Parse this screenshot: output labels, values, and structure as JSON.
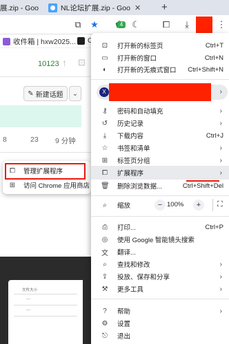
{
  "tabs": [
    {
      "title": "展.zip - Goo"
    },
    {
      "title": "NL论坛扩展.zip - Goo"
    }
  ],
  "new_tab_glyph": "+",
  "toolbar": {
    "extension_badge": "4",
    "icons": [
      "cast-icon",
      "bookmark-star-icon",
      "extension-shield-icon",
      "moon-icon",
      "puzzle-icon",
      "download-icon",
      "kebab-menu-icon"
    ]
  },
  "bookmarks": [
    {
      "label": "收件箱 | hxw2025..."
    },
    {
      "label": "Crea"
    }
  ],
  "page": {
    "count": "10123",
    "new_topic_label": "新建话题",
    "stats": [
      "8",
      "23",
      "9 分钟"
    ],
    "file_size_label": "文件大小"
  },
  "submenu": {
    "items": [
      {
        "label": "管理扩展程序",
        "icon": "puzzle-icon"
      },
      {
        "label": "访问 Chrome 应用商店",
        "icon": "store-icon"
      }
    ]
  },
  "menu": {
    "new_tab": {
      "label": "打开新的标签页",
      "shortcut": "Ctrl+T"
    },
    "new_window": {
      "label": "打开新的窗口",
      "shortcut": "Ctrl+N"
    },
    "incognito": {
      "label": "打开新的无痕式窗口",
      "shortcut": "Ctrl+Shift+N"
    },
    "profile_initial": "X",
    "passwords": {
      "label": "密码和自动填充"
    },
    "history": {
      "label": "历史记录"
    },
    "downloads": {
      "label": "下载内容",
      "shortcut": "Ctrl+J"
    },
    "bookmarks": {
      "label": "书签和清单"
    },
    "tab_groups": {
      "label": "标签页分组"
    },
    "extensions": {
      "label": "扩展程序"
    },
    "clear_data": {
      "label": "删除浏览数据...",
      "shortcut": "Ctrl+Shift+Del"
    },
    "zoom": {
      "label": "缩放",
      "value": "100%",
      "minus": "−",
      "plus": "+"
    },
    "print": {
      "label": "打印...",
      "shortcut": "Ctrl+P"
    },
    "lens": {
      "label": "使用 Google 智能镜头搜索"
    },
    "translate": {
      "label": "翻译..."
    },
    "find_edit": {
      "label": "查找和修改"
    },
    "cast_save": {
      "label": "投放、保存和分享"
    },
    "more_tools": {
      "label": "更多工具"
    },
    "help": {
      "label": "帮助"
    },
    "settings": {
      "label": "设置"
    },
    "exit": {
      "label": "退出"
    }
  },
  "colors": {
    "highlight_red": "#e8180c",
    "menu_hover": "#e8eaed",
    "count_green": "#2e7d32",
    "mint": "#dcf7ee"
  }
}
